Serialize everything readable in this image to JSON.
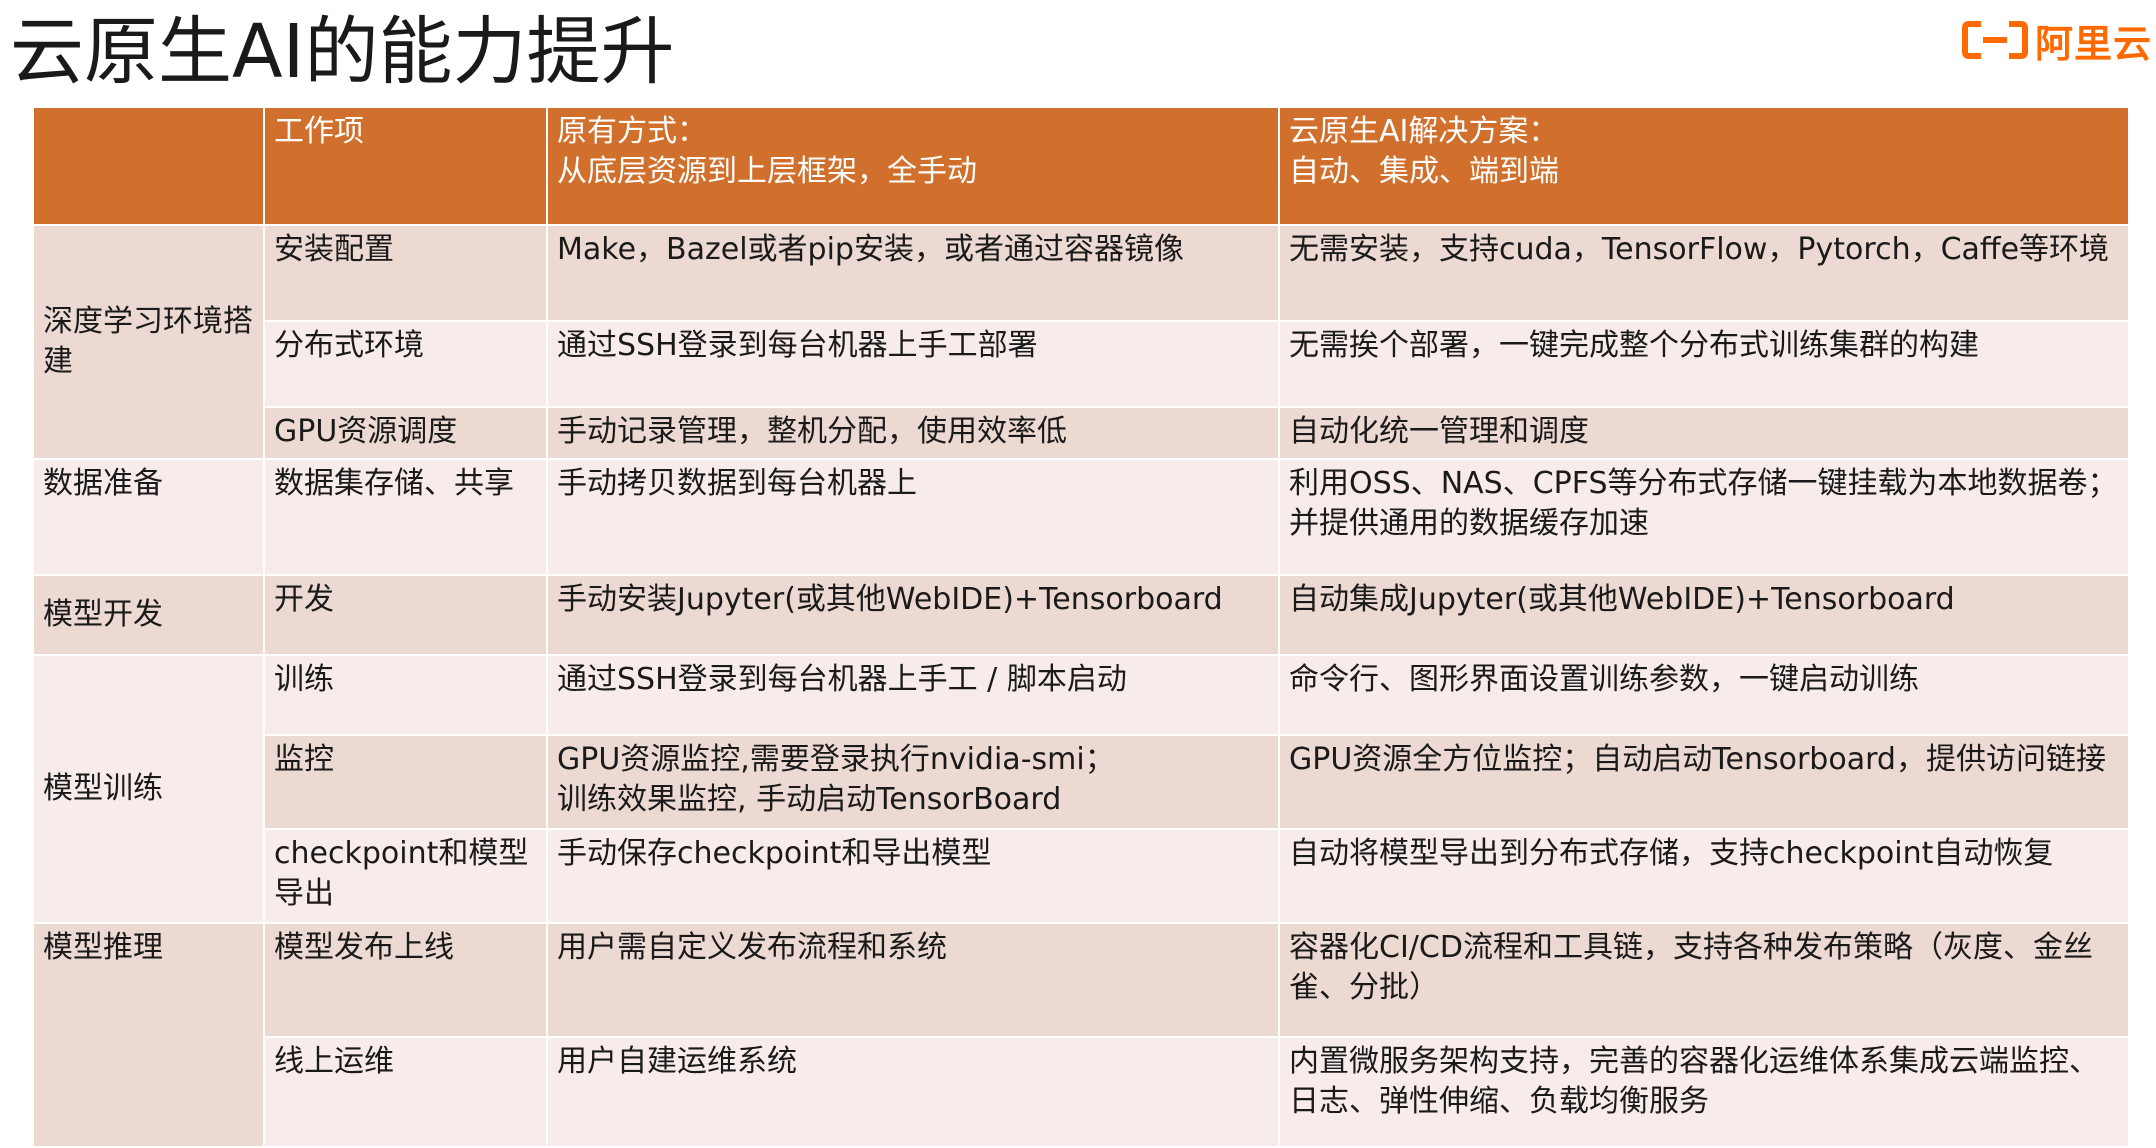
{
  "title": "云原生AI的能力提升",
  "brand": {
    "logo_icon": "aliyun-logo-icon",
    "name": "阿里云",
    "color": "#ff6a00"
  },
  "colors": {
    "header_bg": "#d0702c",
    "row_dark": "#ecd9d2",
    "row_light": "#f7ecea"
  },
  "table": {
    "headers": {
      "category": "",
      "work_item": "工作项",
      "original": "原有方式：\n从底层资源到上层框架，全手动",
      "cloud_native": "云原生AI解决方案：\n自动、集成、端到端"
    },
    "groups": [
      {
        "label": "深度学习环境搭建",
        "rows": [
          {
            "item": "安装配置",
            "original": "Make，Bazel或者pip安装，或者通过容器镜像",
            "cloud": "无需安装，支持cuda，TensorFlow，Pytorch，Caffe等环境"
          },
          {
            "item": "分布式环境",
            "original": "通过SSH登录到每台机器上手工部署",
            "cloud": "无需挨个部署，一键完成整个分布式训练集群的构建"
          },
          {
            "item": "GPU资源调度",
            "original": "手动记录管理，整机分配，使用效率低",
            "cloud": "自动化统一管理和调度"
          }
        ]
      },
      {
        "label": "数据准备",
        "rows": [
          {
            "item": "数据集存储、共享",
            "original": "手动拷贝数据到每台机器上",
            "cloud": "利用OSS、NAS、CPFS等分布式存储一键挂载为本地数据卷；\n并提供通用的数据缓存加速"
          }
        ]
      },
      {
        "label": "模型开发",
        "rows": [
          {
            "item": "开发",
            "original": "手动安装Jupyter(或其他WebIDE)+Tensorboard",
            "cloud": "自动集成Jupyter(或其他WebIDE)+Tensorboard"
          }
        ]
      },
      {
        "label": "模型训练",
        "rows": [
          {
            "item": "训练",
            "original": "通过SSH登录到每台机器上手工 / 脚本启动",
            "cloud": "命令行、图形界面设置训练参数，一键启动训练"
          },
          {
            "item": "监控",
            "original": "GPU资源监控,需要登录执行nvidia-smi；\n训练效果监控, 手动启动TensorBoard",
            "cloud": "GPU资源全方位监控；自动启动Tensorboard，提供访问链接"
          },
          {
            "item": "checkpoint和模型导出",
            "original": "手动保存checkpoint和导出模型",
            "cloud": "自动将模型导出到分布式存储，支持checkpoint自动恢复"
          }
        ]
      },
      {
        "label": "模型推理",
        "rows": [
          {
            "item": "模型发布上线",
            "original": "用户需自定义发布流程和系统",
            "cloud": "容器化CI/CD流程和工具链，支持各种发布策略（灰度、金丝雀、分批）"
          },
          {
            "item": "线上运维",
            "original": "用户自建运维系统",
            "cloud": "内置微服务架构支持，完善的容器化运维体系集成云端监控、日志、弹性伸缩、负载均衡服务"
          }
        ]
      }
    ]
  }
}
